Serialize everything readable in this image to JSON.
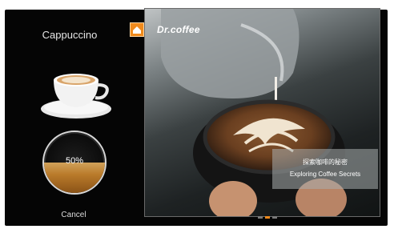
{
  "drink": {
    "name": "Cappuccino"
  },
  "progress": {
    "value": 0.5,
    "label": "50%",
    "fill_color": "#b97a2a"
  },
  "actions": {
    "cancel_label": "Cancel"
  },
  "slideshow": {
    "brand": "Dr.coffee",
    "caption_cn": "探索咖啡的秘密",
    "caption_en": "Exploring Coffee Secrets",
    "slides": [
      {
        "label": "slide 1",
        "active": false
      },
      {
        "label": "slide 2",
        "active": true
      },
      {
        "label": "slide 3",
        "active": false
      }
    ]
  },
  "icons": {
    "home": "home-icon",
    "cup": "coffee-cup-icon"
  },
  "colors": {
    "accent": "#f08a1c",
    "background": "#050505"
  }
}
